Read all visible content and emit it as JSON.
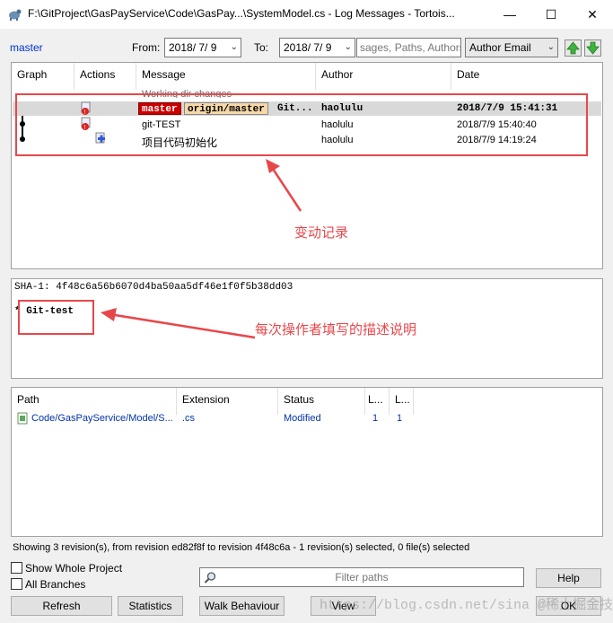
{
  "window": {
    "title": "F:\\GitProject\\GasPayService\\Code\\GasPay...\\SystemModel.cs - Log Messages - Tortois...",
    "minimize": "—",
    "maximize": "☐",
    "close": "✕"
  },
  "toolbar": {
    "branch": "master",
    "from_label": "From:",
    "from_value": "2018/ 7/ 9",
    "to_label": "To:",
    "to_value": "2018/ 7/ 9",
    "search_placeholder": "sages, Paths, Authors, E",
    "filter_mode": "Author Email"
  },
  "log": {
    "columns": [
      "Graph",
      "Actions",
      "Message",
      "Author",
      "Date"
    ],
    "working_dir": "Working dir changes",
    "rows": [
      {
        "tags": [
          "master",
          "origin/master"
        ],
        "message": "Git...",
        "author": "haolulu",
        "date": "2018/7/9 15:41:31"
      },
      {
        "tags": [],
        "message": "git-TEST",
        "author": "haolulu",
        "date": "2018/7/9 15:40:40"
      },
      {
        "tags": [],
        "message": "项目代码初始化",
        "author": "haolulu",
        "date": "2018/7/9 14:19:24"
      }
    ]
  },
  "annotations": {
    "changes": "变动记录",
    "description": "每次操作者填写的描述说明"
  },
  "commit": {
    "sha": "SHA-1: 4f48c6a56b6070d4ba50aa5df46e1f0f5b38dd03",
    "message": "* Git-test"
  },
  "files": {
    "columns": [
      "Path",
      "Extension",
      "Status",
      "L...",
      "L..."
    ],
    "rows": [
      {
        "path": "Code/GasPayService/Model/S...",
        "ext": ".cs",
        "status": "Modified",
        "l1": "1",
        "l2": "1"
      }
    ]
  },
  "status_text": "Showing 3 revision(s), from revision ed82f8f to revision 4f48c6a - 1 revision(s) selected, 0 file(s) selected",
  "options": {
    "show_whole_project": "Show Whole Project",
    "all_branches": "All Branches"
  },
  "filter_paths_placeholder": "Filter paths",
  "buttons": {
    "help": "Help",
    "refresh": "Refresh",
    "statistics": "Statistics",
    "walk": "Walk Behaviour",
    "view": "View",
    "ok": "OK"
  },
  "watermark": "https://blog.csdn.net/sina @稀土掘金技术社区",
  "colors": {
    "annotation": "#e8474a",
    "master_badge": "#cc0000",
    "origin_badge": "#f6d8a8",
    "link": "#0033aa"
  }
}
